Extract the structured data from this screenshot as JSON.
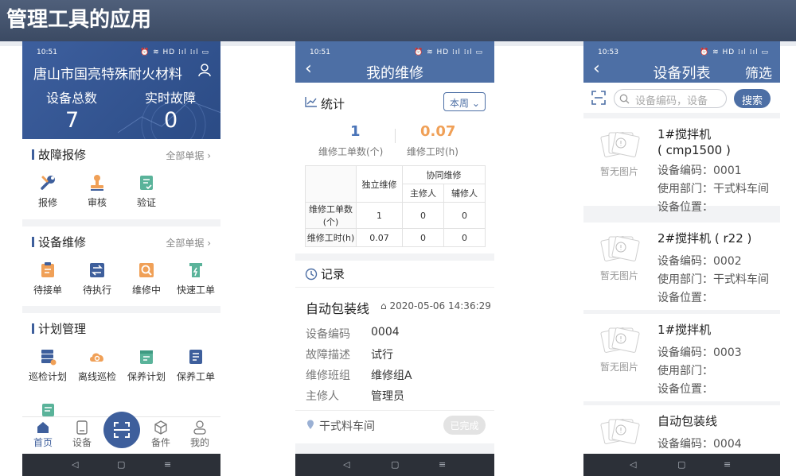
{
  "slide_title": "管理工具的应用",
  "status": {
    "p1_time": "10:51",
    "p2_time": "10:51",
    "p3_time": "10:53",
    "icons": "⏰ ≋ HD ⁞ıl ⁞ıl ▭"
  },
  "home": {
    "company": "唐山市国亮特殊耐火材料",
    "stats": [
      {
        "label": "设备总数",
        "value": "7"
      },
      {
        "label": "实时故障",
        "value": "0"
      }
    ],
    "fault": {
      "title": "故障报修",
      "link": "全部单据 ›",
      "items": [
        "报修",
        "审核",
        "验证"
      ]
    },
    "maint": {
      "title": "设备维修",
      "link": "全部单据 ›",
      "items": [
        "待接单",
        "待执行",
        "维修中",
        "快速工单"
      ]
    },
    "plan": {
      "title": "计划管理",
      "items": [
        "巡检计划",
        "离线巡检",
        "保养计划",
        "保养工单"
      ]
    },
    "tabs": [
      "首页",
      "设备",
      "备件",
      "我的"
    ]
  },
  "repair": {
    "title": "我的维修",
    "stats_title": "统计",
    "period": "本周 ⌄",
    "count": "1",
    "count_label": "维修工单数(个)",
    "hours": "0.07",
    "hours_label": "维修工时(h)",
    "table": {
      "h_independent": "独立维修",
      "h_collab": "协同维修",
      "h_main": "主修人",
      "h_assist": "辅修人",
      "rows": [
        {
          "label": "维修工单数(个)",
          "cells": [
            "1",
            "0",
            "0"
          ]
        },
        {
          "label": "维修工时(h)",
          "cells": [
            "0.07",
            "0",
            "0"
          ]
        }
      ]
    },
    "record_title": "记录",
    "record": {
      "name": "自动包装线",
      "datetime": "2020-05-06 14:36:29",
      "fields": [
        {
          "k": "设备编码",
          "v": "0004"
        },
        {
          "k": "故障描述",
          "v": "试行"
        },
        {
          "k": "维修班组",
          "v": "维修组A"
        },
        {
          "k": "主修人",
          "v": "管理员"
        }
      ],
      "location": "干式料车间",
      "status": "已完成"
    }
  },
  "devices": {
    "title": "设备列表",
    "filter": "筛选",
    "search_placeholder": "设备编码，设备",
    "search_btn": "搜索",
    "no_image": "暂无图片",
    "items": [
      {
        "name": "1#搅拌机",
        "name2": "( cmp1500 )",
        "code": "设备编码：0001",
        "dept": "使用部门：干式料车间",
        "loc": "设备位置："
      },
      {
        "name": "2#搅拌机 ( r22 )",
        "name2": "",
        "code": "设备编码：0002",
        "dept": "使用部门：干式料车间",
        "loc": "设备位置："
      },
      {
        "name": "1#搅拌机",
        "name2": "",
        "code": "设备编码：0003",
        "dept": "使用部门：",
        "loc": "设备位置："
      },
      {
        "name": "自动包装线",
        "name2": "",
        "code": "设备编码：0004",
        "dept": "",
        "loc": ""
      }
    ]
  },
  "colors": {
    "primary": "#4d6fa5",
    "header": "#3b4a63",
    "accent_orange": "#f0a057",
    "accent_blue": "#4a74b8"
  }
}
